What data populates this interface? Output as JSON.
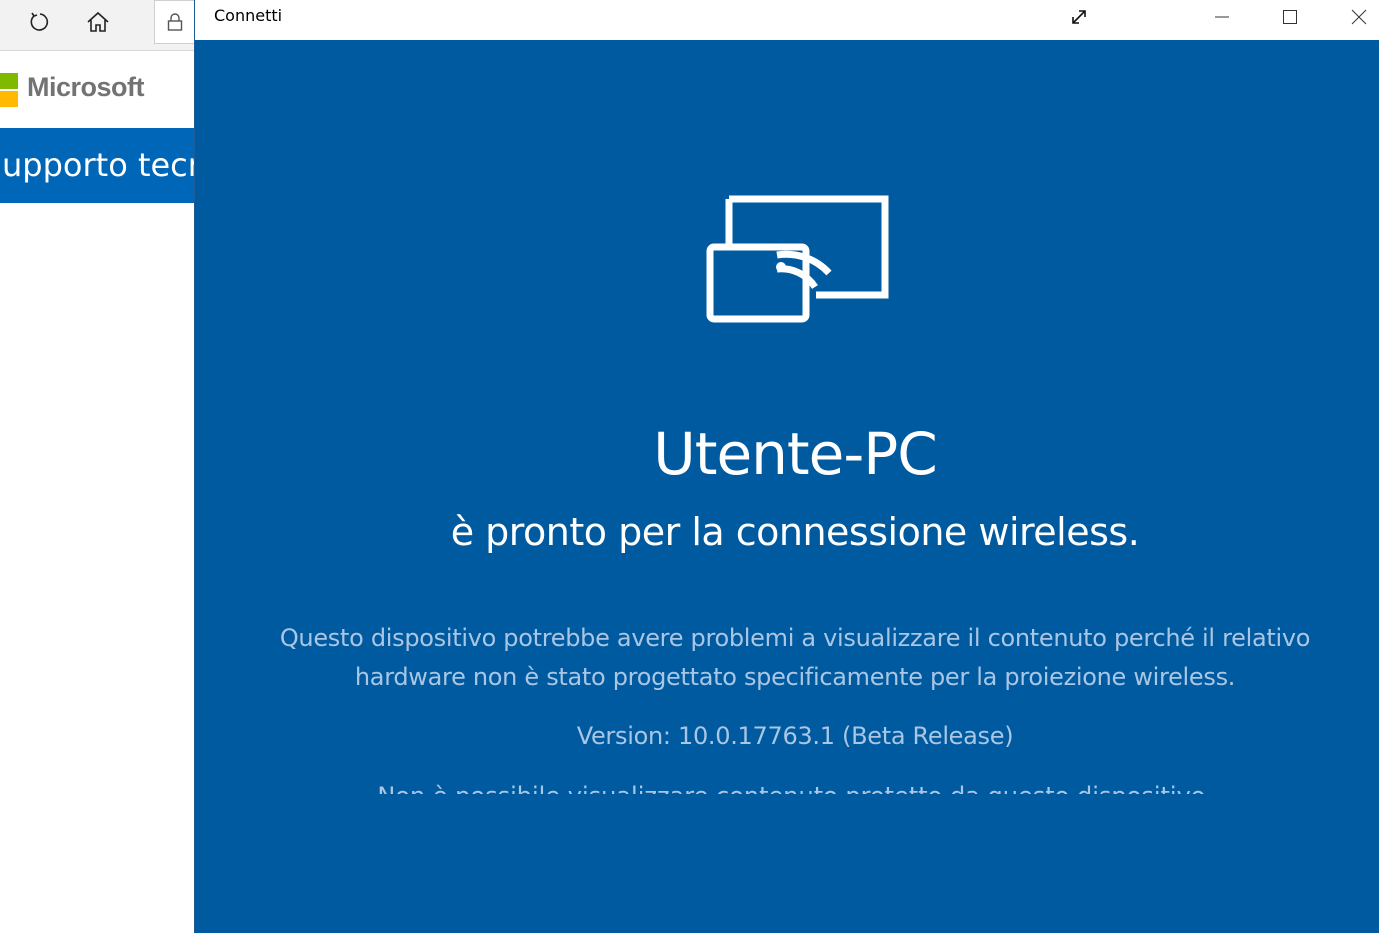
{
  "browser": {
    "refresh_icon": "refresh-icon",
    "home_icon": "home-icon",
    "lock_icon": "lock-icon",
    "brand": "Microsoft",
    "support_banner": "upporto tecr",
    "colors": {
      "logo_green": "#7fba00",
      "logo_yellow": "#ffb900",
      "banner": "#0067b8"
    }
  },
  "window": {
    "title": "Connetti",
    "buttons": {
      "expand_icon": "expand-icon",
      "minimize_icon": "minimize-icon",
      "maximize_icon": "maximize-icon",
      "close_icon": "close-icon"
    },
    "background": "#005aa0"
  },
  "main": {
    "icon": "wireless-display-icon",
    "device_name": "Utente-PC",
    "ready_message": "è pronto per la connessione wireless.",
    "warning": "Questo dispositivo potrebbe avere problemi a visualizzare il contenuto perché il relativo hardware non è stato progettato specificamente per la proiezione wireless.",
    "version": "Version: 10.0.17763.1 (Beta Release)",
    "clipped_line": "Non è possibile visualizzare contenuto protetto da questo dispositivo."
  }
}
